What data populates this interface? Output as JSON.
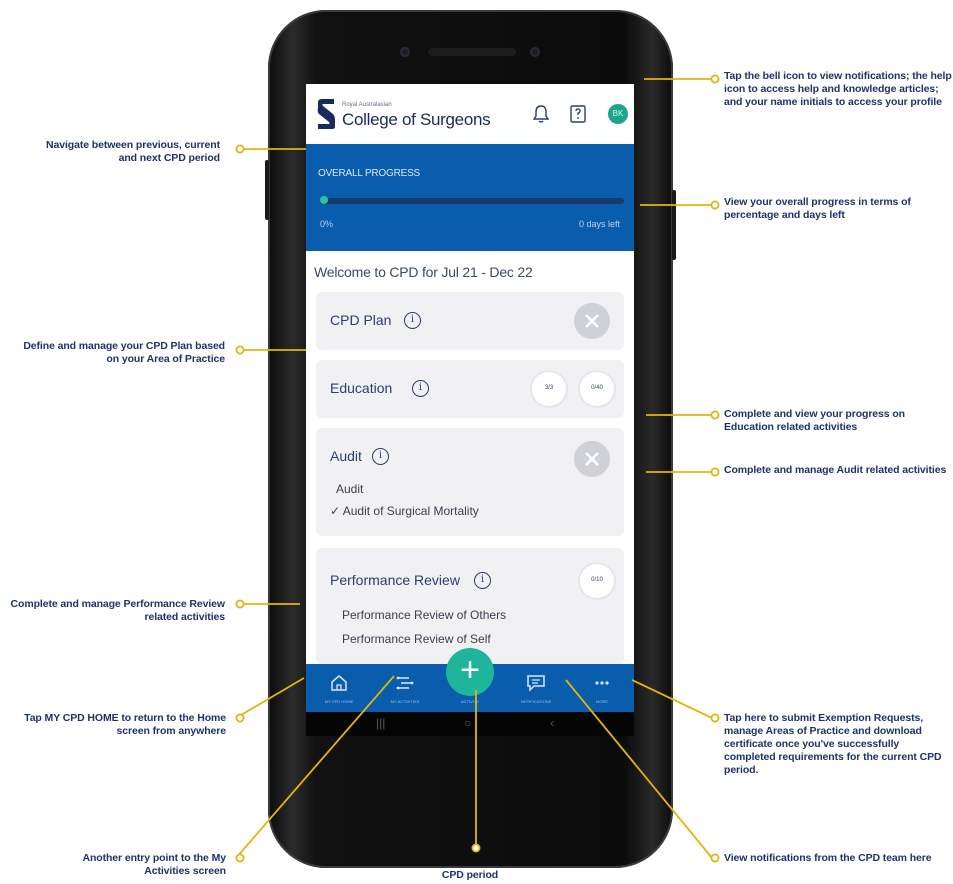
{
  "annotations": {
    "navigate_period": "Navigate between previous, current and next CPD period",
    "define_plan": "Define and manage your CPD Plan based on your Area of Practice",
    "performance_review": "Complete and manage Performance Review related activities",
    "cpd_home": "Tap MY CPD HOME to return to the Home screen from anywhere",
    "activities_entry": "Another entry point to the My Activities screen",
    "add_activity": "Tap here to add Activity for the current CPD period",
    "bell_help_profile": "Tap the bell icon to view notifications; the help icon to access help and knowledge articles; and your name initials to access your profile",
    "overall_progress": "View your overall progress in terms of percentage and days left",
    "education_progress": "Complete and view your progress on Education related activities",
    "audit_manage": "Complete and manage Audit related activities",
    "more_menu": "Tap here to submit Exemption Requests, manage Areas of Practice and download certificate once you've successfully completed requirements for the current CPD period.",
    "notifications": "View notifications from the CPD team here"
  },
  "app": {
    "logo_small": "Royal Australasian",
    "logo_big": "College of Surgeons",
    "avatar_initials": "BK",
    "progress": {
      "label": "OVERALL PROGRESS",
      "percent_text": "0%",
      "days_text": "0 days left",
      "percent_value": 0
    },
    "welcome": "Welcome to CPD for Jul 21 - Dec 22",
    "cards": {
      "cpd_plan": {
        "title": "CPD Plan"
      },
      "education": {
        "title": "Education",
        "ring1": "3/3",
        "ring2": "0/40"
      },
      "audit": {
        "title": "Audit",
        "items": [
          "Audit",
          "✓ Audit of Surgical Mortality"
        ]
      },
      "performance_review": {
        "title": "Performance Review",
        "ring": "0/10",
        "items": [
          "Performance Review of Others",
          "Performance Review of Self"
        ]
      }
    },
    "bottom_nav": {
      "home": "MY CPD HOME",
      "activities": "MY ACTIVITIES",
      "add": "ACTIVITY",
      "notifications": "NOTIFICATIONS",
      "more": "MORE"
    },
    "fab_label": "+"
  },
  "colors": {
    "brand_blue": "#0a5cad",
    "accent_teal": "#1fb59b",
    "callout_gold": "#e3b40f",
    "annotation_navy": "#1f3367"
  },
  "icons": [
    "bell-icon",
    "help-icon",
    "home-icon",
    "activities-icon",
    "plus-icon",
    "chat-icon",
    "more-icon",
    "info-icon",
    "close-icon"
  ]
}
